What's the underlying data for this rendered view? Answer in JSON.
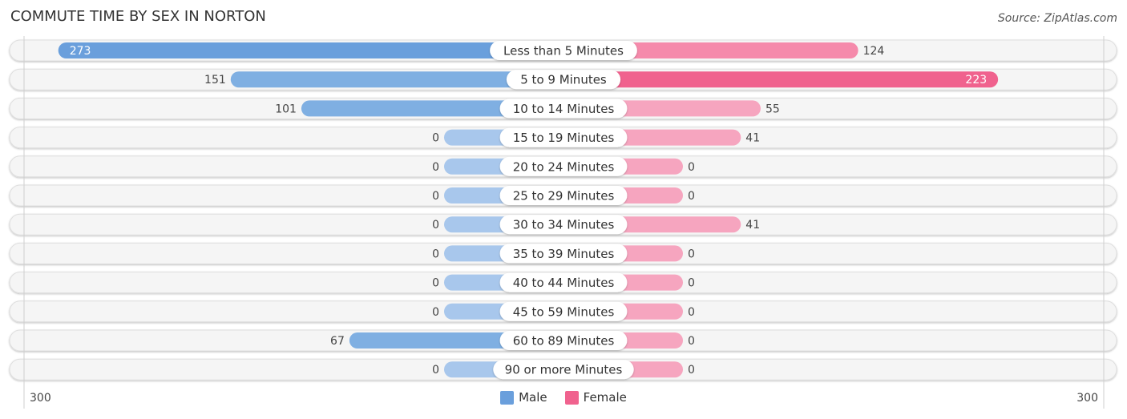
{
  "header": {
    "title": "COMMUTE TIME BY SEX IN NORTON",
    "source": "Source: ZipAtlas.com"
  },
  "colors": {
    "male": "#6a9fdc",
    "male_light": "#a8c7ec",
    "female": "#f0628e",
    "female_light": "#f6a5bf"
  },
  "chart_data": {
    "type": "bar",
    "orientation": "horizontal-diverging",
    "title": "COMMUTE TIME BY SEX IN NORTON",
    "categories": [
      "Less than 5 Minutes",
      "5 to 9 Minutes",
      "10 to 14 Minutes",
      "15 to 19 Minutes",
      "20 to 24 Minutes",
      "25 to 29 Minutes",
      "30 to 34 Minutes",
      "35 to 39 Minutes",
      "40 to 44 Minutes",
      "45 to 59 Minutes",
      "60 to 89 Minutes",
      "90 or more Minutes"
    ],
    "series": [
      {
        "name": "Male",
        "values": [
          273,
          151,
          101,
          0,
          0,
          0,
          0,
          0,
          0,
          0,
          67,
          0
        ]
      },
      {
        "name": "Female",
        "values": [
          124,
          223,
          55,
          41,
          0,
          0,
          41,
          0,
          0,
          0,
          0,
          0
        ]
      }
    ],
    "axis": {
      "left_label": "300",
      "right_label": "300",
      "max": 300
    },
    "legend": {
      "position": "bottom-center",
      "entries": [
        "Male",
        "Female"
      ]
    }
  }
}
